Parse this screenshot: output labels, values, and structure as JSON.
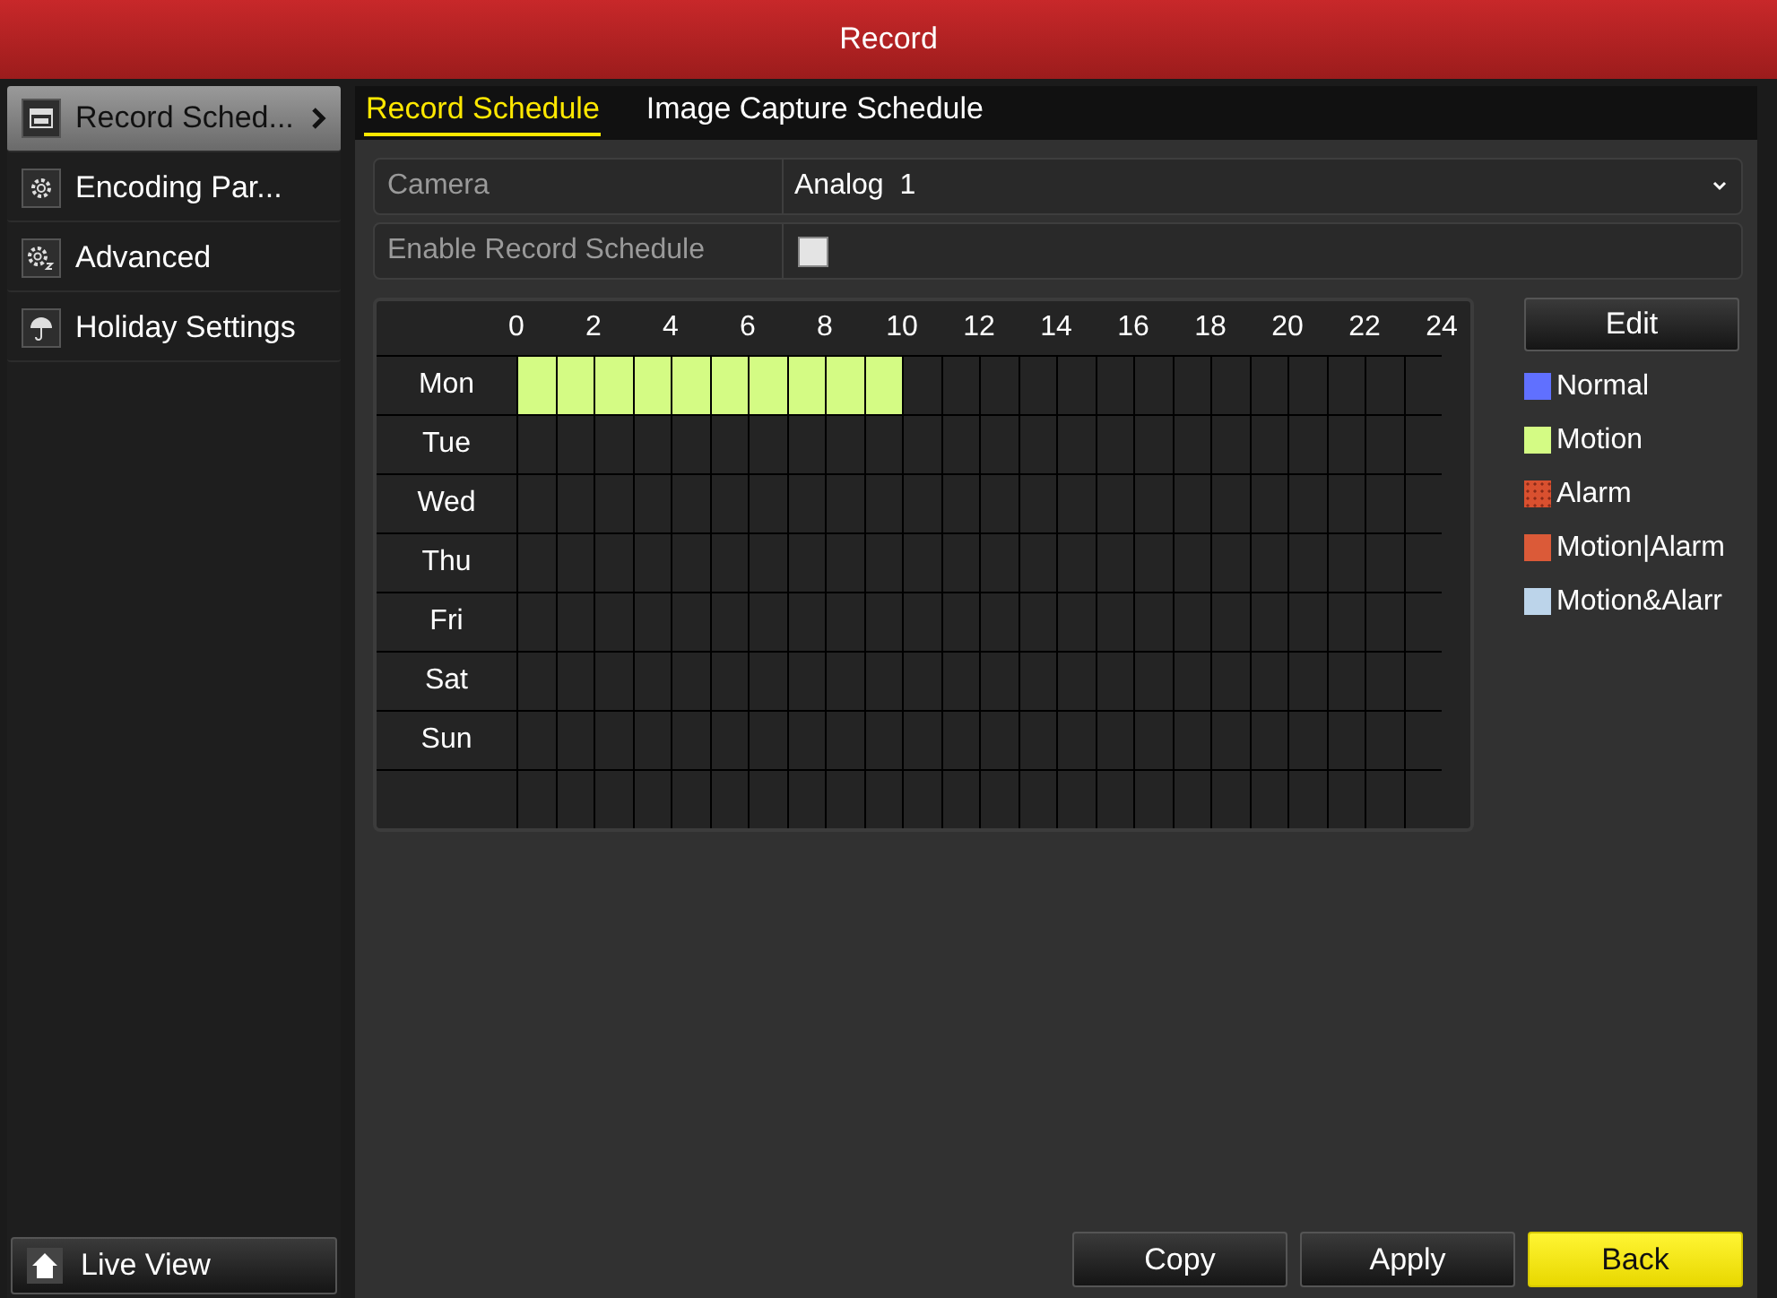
{
  "window": {
    "title": "Record"
  },
  "sidebar": {
    "items": [
      {
        "label": "Record Sched...",
        "selected": true
      },
      {
        "label": "Encoding Par...",
        "selected": false
      },
      {
        "label": "Advanced",
        "selected": false
      },
      {
        "label": "Holiday Settings",
        "selected": false
      }
    ],
    "bottom_button": {
      "label": "Live View"
    }
  },
  "tabs": [
    {
      "label": "Record Schedule",
      "selected": true
    },
    {
      "label": "Image Capture Schedule",
      "selected": false
    }
  ],
  "form": {
    "camera": {
      "label": "Camera",
      "value": "Analog  1"
    },
    "enable": {
      "label": "Enable Record Schedule",
      "checked": false
    }
  },
  "schedule": {
    "hours": [
      "0",
      "2",
      "4",
      "6",
      "8",
      "10",
      "12",
      "14",
      "16",
      "18",
      "20",
      "22",
      "24"
    ],
    "days": [
      {
        "name": "Mon",
        "cells": [
          {
            "kind": "motion"
          },
          {
            "kind": "motion"
          },
          {
            "kind": "motion"
          },
          {
            "kind": "motion"
          },
          {
            "kind": "motion"
          },
          {
            "kind": "motion"
          },
          {
            "kind": "motion"
          },
          {
            "kind": "motion"
          },
          {
            "kind": "motion"
          },
          {
            "kind": "motion"
          },
          {
            "kind": "none"
          },
          {
            "kind": "none"
          },
          {
            "kind": "none"
          },
          {
            "kind": "none"
          },
          {
            "kind": "none"
          },
          {
            "kind": "none"
          },
          {
            "kind": "none"
          },
          {
            "kind": "none"
          },
          {
            "kind": "none"
          },
          {
            "kind": "none"
          },
          {
            "kind": "none"
          },
          {
            "kind": "none"
          },
          {
            "kind": "none"
          },
          {
            "kind": "none"
          }
        ]
      },
      {
        "name": "Tue",
        "cells": [
          {
            "kind": "none"
          },
          {
            "kind": "none"
          },
          {
            "kind": "none"
          },
          {
            "kind": "none"
          },
          {
            "kind": "none"
          },
          {
            "kind": "none"
          },
          {
            "kind": "none"
          },
          {
            "kind": "none"
          },
          {
            "kind": "none"
          },
          {
            "kind": "none"
          },
          {
            "kind": "none"
          },
          {
            "kind": "none"
          },
          {
            "kind": "none"
          },
          {
            "kind": "none"
          },
          {
            "kind": "none"
          },
          {
            "kind": "none"
          },
          {
            "kind": "none"
          },
          {
            "kind": "none"
          },
          {
            "kind": "none"
          },
          {
            "kind": "none"
          },
          {
            "kind": "none"
          },
          {
            "kind": "none"
          },
          {
            "kind": "none"
          },
          {
            "kind": "none"
          }
        ]
      },
      {
        "name": "Wed",
        "cells": [
          {
            "kind": "none"
          },
          {
            "kind": "none"
          },
          {
            "kind": "none"
          },
          {
            "kind": "none"
          },
          {
            "kind": "none"
          },
          {
            "kind": "none"
          },
          {
            "kind": "none"
          },
          {
            "kind": "none"
          },
          {
            "kind": "none"
          },
          {
            "kind": "none"
          },
          {
            "kind": "none"
          },
          {
            "kind": "none"
          },
          {
            "kind": "none"
          },
          {
            "kind": "none"
          },
          {
            "kind": "none"
          },
          {
            "kind": "none"
          },
          {
            "kind": "none"
          },
          {
            "kind": "none"
          },
          {
            "kind": "none"
          },
          {
            "kind": "none"
          },
          {
            "kind": "none"
          },
          {
            "kind": "none"
          },
          {
            "kind": "none"
          },
          {
            "kind": "none"
          }
        ]
      },
      {
        "name": "Thu",
        "cells": [
          {
            "kind": "none"
          },
          {
            "kind": "none"
          },
          {
            "kind": "none"
          },
          {
            "kind": "none"
          },
          {
            "kind": "none"
          },
          {
            "kind": "none"
          },
          {
            "kind": "none"
          },
          {
            "kind": "none"
          },
          {
            "kind": "none"
          },
          {
            "kind": "none"
          },
          {
            "kind": "none"
          },
          {
            "kind": "none"
          },
          {
            "kind": "none"
          },
          {
            "kind": "none"
          },
          {
            "kind": "none"
          },
          {
            "kind": "none"
          },
          {
            "kind": "none"
          },
          {
            "kind": "none"
          },
          {
            "kind": "none"
          },
          {
            "kind": "none"
          },
          {
            "kind": "none"
          },
          {
            "kind": "none"
          },
          {
            "kind": "none"
          },
          {
            "kind": "none"
          }
        ]
      },
      {
        "name": "Fri",
        "cells": [
          {
            "kind": "none"
          },
          {
            "kind": "none"
          },
          {
            "kind": "none"
          },
          {
            "kind": "none"
          },
          {
            "kind": "none"
          },
          {
            "kind": "none"
          },
          {
            "kind": "none"
          },
          {
            "kind": "none"
          },
          {
            "kind": "none"
          },
          {
            "kind": "none"
          },
          {
            "kind": "none"
          },
          {
            "kind": "none"
          },
          {
            "kind": "none"
          },
          {
            "kind": "none"
          },
          {
            "kind": "none"
          },
          {
            "kind": "none"
          },
          {
            "kind": "none"
          },
          {
            "kind": "none"
          },
          {
            "kind": "none"
          },
          {
            "kind": "none"
          },
          {
            "kind": "none"
          },
          {
            "kind": "none"
          },
          {
            "kind": "none"
          },
          {
            "kind": "none"
          }
        ]
      },
      {
        "name": "Sat",
        "cells": [
          {
            "kind": "none"
          },
          {
            "kind": "none"
          },
          {
            "kind": "none"
          },
          {
            "kind": "none"
          },
          {
            "kind": "none"
          },
          {
            "kind": "none"
          },
          {
            "kind": "none"
          },
          {
            "kind": "none"
          },
          {
            "kind": "none"
          },
          {
            "kind": "none"
          },
          {
            "kind": "none"
          },
          {
            "kind": "none"
          },
          {
            "kind": "none"
          },
          {
            "kind": "none"
          },
          {
            "kind": "none"
          },
          {
            "kind": "none"
          },
          {
            "kind": "none"
          },
          {
            "kind": "none"
          },
          {
            "kind": "none"
          },
          {
            "kind": "none"
          },
          {
            "kind": "none"
          },
          {
            "kind": "none"
          },
          {
            "kind": "none"
          },
          {
            "kind": "none"
          }
        ]
      },
      {
        "name": "Sun",
        "cells": [
          {
            "kind": "none"
          },
          {
            "kind": "none"
          },
          {
            "kind": "none"
          },
          {
            "kind": "none"
          },
          {
            "kind": "none"
          },
          {
            "kind": "none"
          },
          {
            "kind": "none"
          },
          {
            "kind": "none"
          },
          {
            "kind": "none"
          },
          {
            "kind": "none"
          },
          {
            "kind": "none"
          },
          {
            "kind": "none"
          },
          {
            "kind": "none"
          },
          {
            "kind": "none"
          },
          {
            "kind": "none"
          },
          {
            "kind": "none"
          },
          {
            "kind": "none"
          },
          {
            "kind": "none"
          },
          {
            "kind": "none"
          },
          {
            "kind": "none"
          },
          {
            "kind": "none"
          },
          {
            "kind": "none"
          },
          {
            "kind": "none"
          },
          {
            "kind": "none"
          }
        ]
      }
    ]
  },
  "edit_button": {
    "label": "Edit"
  },
  "legend": [
    {
      "kind": "normal",
      "label": "Normal",
      "color": "#6070ff"
    },
    {
      "kind": "motion",
      "label": "Motion",
      "color": "#d4fb84"
    },
    {
      "kind": "alarm",
      "label": "Alarm",
      "color": "#d9502f"
    },
    {
      "kind": "motion_or_alarm",
      "label": "Motion|Alarm",
      "color": "#db5a38"
    },
    {
      "kind": "motion_and_alarm",
      "label": "Motion&Alarr",
      "color": "#bcd4ea"
    }
  ],
  "buttons": [
    {
      "label": "Copy",
      "kind": "normal"
    },
    {
      "label": "Apply",
      "kind": "normal"
    },
    {
      "label": "Back",
      "kind": "primary"
    }
  ]
}
